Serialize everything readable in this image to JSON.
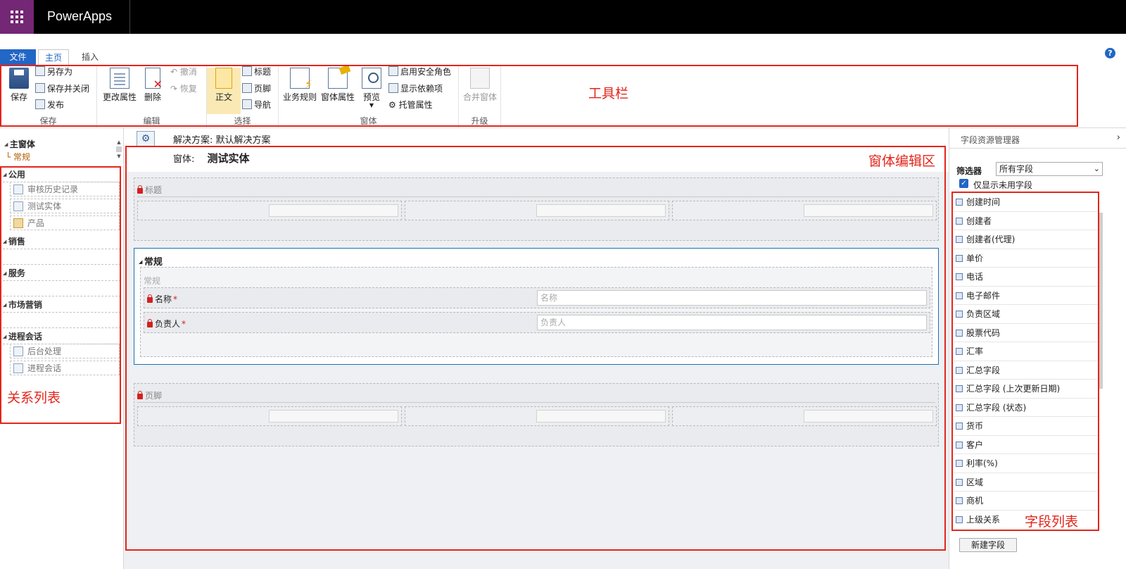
{
  "app": {
    "title": "PowerApps"
  },
  "tabs": {
    "file": "文件",
    "home": "主页",
    "insert": "插入",
    "help": "?"
  },
  "ribbon": {
    "save_group": {
      "save": "保存",
      "save_as": "另存为",
      "save_close": "保存并关闭",
      "publish": "发布",
      "label": "保存"
    },
    "edit_group": {
      "change_props": "更改属性",
      "delete": "删除",
      "undo": "撤消",
      "redo": "恢复",
      "label": "编辑"
    },
    "select_group": {
      "body": "正文",
      "header": "标题",
      "footer": "页脚",
      "nav": "导航",
      "label": "选择"
    },
    "form_group": {
      "business_rules": "业务规则",
      "form_props": "窗体属性",
      "preview": "预览",
      "enable_roles": "启用安全角色",
      "show_deps": "显示依赖项",
      "managed_props": "托管属性",
      "label": "窗体"
    },
    "upgrade_group": {
      "merge_forms": "合并窗体",
      "label": "升级"
    }
  },
  "annotations": {
    "toolbar": "工具栏",
    "form_editor": "窗体编辑区",
    "relation_list": "关系列表",
    "field_list": "字段列表"
  },
  "left_nav": {
    "main_form": "主窗体",
    "general": "常规",
    "common": "公用",
    "common_items": [
      "审核历史记录",
      "测试实体",
      "产品"
    ],
    "sales": "销售",
    "service": "服务",
    "marketing": "市场营销",
    "process": "进程会话",
    "process_items": [
      "后台处理",
      "进程会话"
    ]
  },
  "form": {
    "solution": "解决方案: 默认解决方案",
    "form_label": "窗体:",
    "entity_name": "测试实体",
    "header_section": "标题",
    "general_tab": "常规",
    "general_section": "常规",
    "fields": [
      {
        "label": "名称",
        "placeholder": "名称"
      },
      {
        "label": "负责人",
        "placeholder": "负责人"
      }
    ],
    "required_mark": "*",
    "footer_section": "页脚"
  },
  "right_panel": {
    "title": "字段资源管理器",
    "filter_label": "筛选器",
    "filter_value": "所有字段",
    "only_unused": "仅显示未用字段",
    "only_unused_checked": true,
    "fields": [
      "创建时间",
      "创建者",
      "创建者(代理)",
      "单价",
      "电话",
      "电子邮件",
      "负责区域",
      "股票代码",
      "汇率",
      "汇总字段",
      "汇总字段 (上次更新日期)",
      "汇总字段 (状态)",
      "货币",
      "客户",
      "利率(%)",
      "区域",
      "商机",
      "上级关系"
    ],
    "new_field": "新建字段"
  },
  "colors": {
    "brand": "#742774",
    "accent": "#2266c6",
    "annotation": "#e3251b",
    "tab_border": "#1d6fb5"
  }
}
